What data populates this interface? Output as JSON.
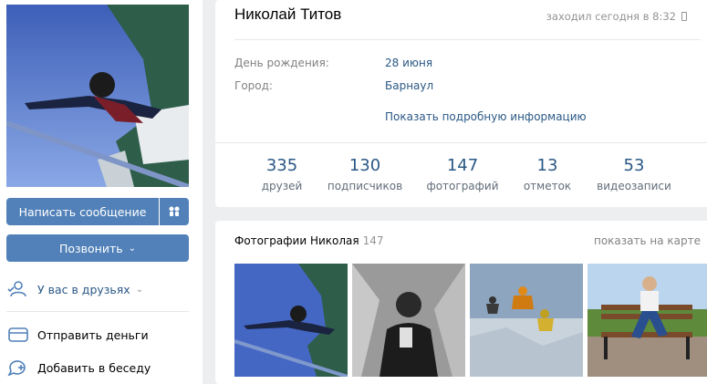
{
  "profile": {
    "name": "Николай Титов",
    "last_seen": "заходил сегодня в 8:32",
    "birthday_label": "День рождения:",
    "birthday_value": "28 июня",
    "city_label": "Город:",
    "city_value": "Барнаул",
    "more_info": "Показать подробную информацию"
  },
  "counters": [
    {
      "num": "335",
      "label": "друзей"
    },
    {
      "num": "130",
      "label": "подписчиков"
    },
    {
      "num": "147",
      "label": "фотографий"
    },
    {
      "num": "13",
      "label": "отметок"
    },
    {
      "num": "53",
      "label": "видеозаписи"
    }
  ],
  "actions": {
    "message": "Написать сообщение",
    "call": "Позвонить",
    "friends": "У вас в друзьях",
    "send_money": "Отправить деньги",
    "add_chat": "Добавить в беседу"
  },
  "photos": {
    "title": "Фотографии Николая",
    "count": "147",
    "map_link": "показать на карте"
  },
  "icons": {
    "gift": "gift-icon",
    "friends": "user-check-icon",
    "money": "wallet-icon",
    "chat": "chat-add-icon",
    "phone": "phone-icon",
    "chevron": "chevron-down-icon"
  },
  "colors": {
    "accent": "#5181b8",
    "link": "#2a5885",
    "bg": "#edeef0"
  }
}
